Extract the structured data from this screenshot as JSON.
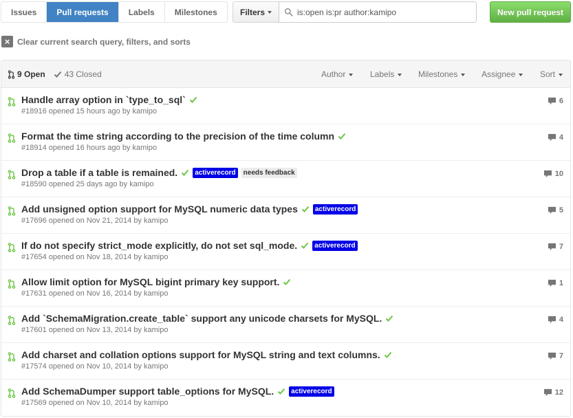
{
  "subnav": [
    {
      "label": "Issues",
      "selected": false
    },
    {
      "label": "Pull requests",
      "selected": true
    },
    {
      "label": "Labels",
      "selected": false
    },
    {
      "label": "Milestones",
      "selected": false
    }
  ],
  "filters_label": "Filters",
  "search_value": "is:open is:pr author:kamipo",
  "new_pr_label": "New pull request",
  "clear_label": "Clear current search query, filters, and sorts",
  "states": {
    "open": "9 Open",
    "closed": "43 Closed"
  },
  "filter_menus": [
    "Author",
    "Labels",
    "Milestones",
    "Assignee",
    "Sort"
  ],
  "pull_requests": [
    {
      "title": "Handle array option in `type_to_sql`",
      "labels": [],
      "number": "#18916",
      "opened_text": "opened 15 hours ago by",
      "author": "kamipo",
      "comments": "6"
    },
    {
      "title": "Format the time string according to the precision of the time column",
      "labels": [],
      "number": "#18914",
      "opened_text": "opened 16 hours ago by",
      "author": "kamipo",
      "comments": "4"
    },
    {
      "title": "Drop a table if a table is remained.",
      "labels": [
        {
          "text": "activerecord",
          "style": "blue"
        },
        {
          "text": "needs feedback",
          "style": "gray"
        }
      ],
      "number": "#18590",
      "opened_text": "opened 25 days ago by",
      "author": "kamipo",
      "comments": "10"
    },
    {
      "title": "Add unsigned option support for MySQL numeric data types",
      "labels": [
        {
          "text": "activerecord",
          "style": "blue"
        }
      ],
      "number": "#17696",
      "opened_text": "opened on Nov 21, 2014 by",
      "author": "kamipo",
      "comments": "5"
    },
    {
      "title": "If do not specify strict_mode explicitly, do not set sql_mode.",
      "labels": [
        {
          "text": "activerecord",
          "style": "blue"
        }
      ],
      "number": "#17654",
      "opened_text": "opened on Nov 18, 2014 by",
      "author": "kamipo",
      "comments": "7"
    },
    {
      "title": "Allow limit option for MySQL bigint primary key support.",
      "labels": [],
      "number": "#17631",
      "opened_text": "opened on Nov 16, 2014 by",
      "author": "kamipo",
      "comments": "1"
    },
    {
      "title": "Add `SchemaMigration.create_table` support any unicode charsets for MySQL.",
      "labels": [],
      "number": "#17601",
      "opened_text": "opened on Nov 13, 2014 by",
      "author": "kamipo",
      "comments": "4"
    },
    {
      "title": "Add charset and collation options support for MySQL string and text columns.",
      "labels": [],
      "number": "#17574",
      "opened_text": "opened on Nov 10, 2014 by",
      "author": "kamipo",
      "comments": "7"
    },
    {
      "title": "Add SchemaDumper support table_options for MySQL.",
      "labels": [
        {
          "text": "activerecord",
          "style": "blue"
        }
      ],
      "number": "#17569",
      "opened_text": "opened on Nov 10, 2014 by",
      "author": "kamipo",
      "comments": "12"
    }
  ],
  "colors": {
    "accent": "#4183c4",
    "green": "#6cc644",
    "label_blue": "#0000e6"
  }
}
